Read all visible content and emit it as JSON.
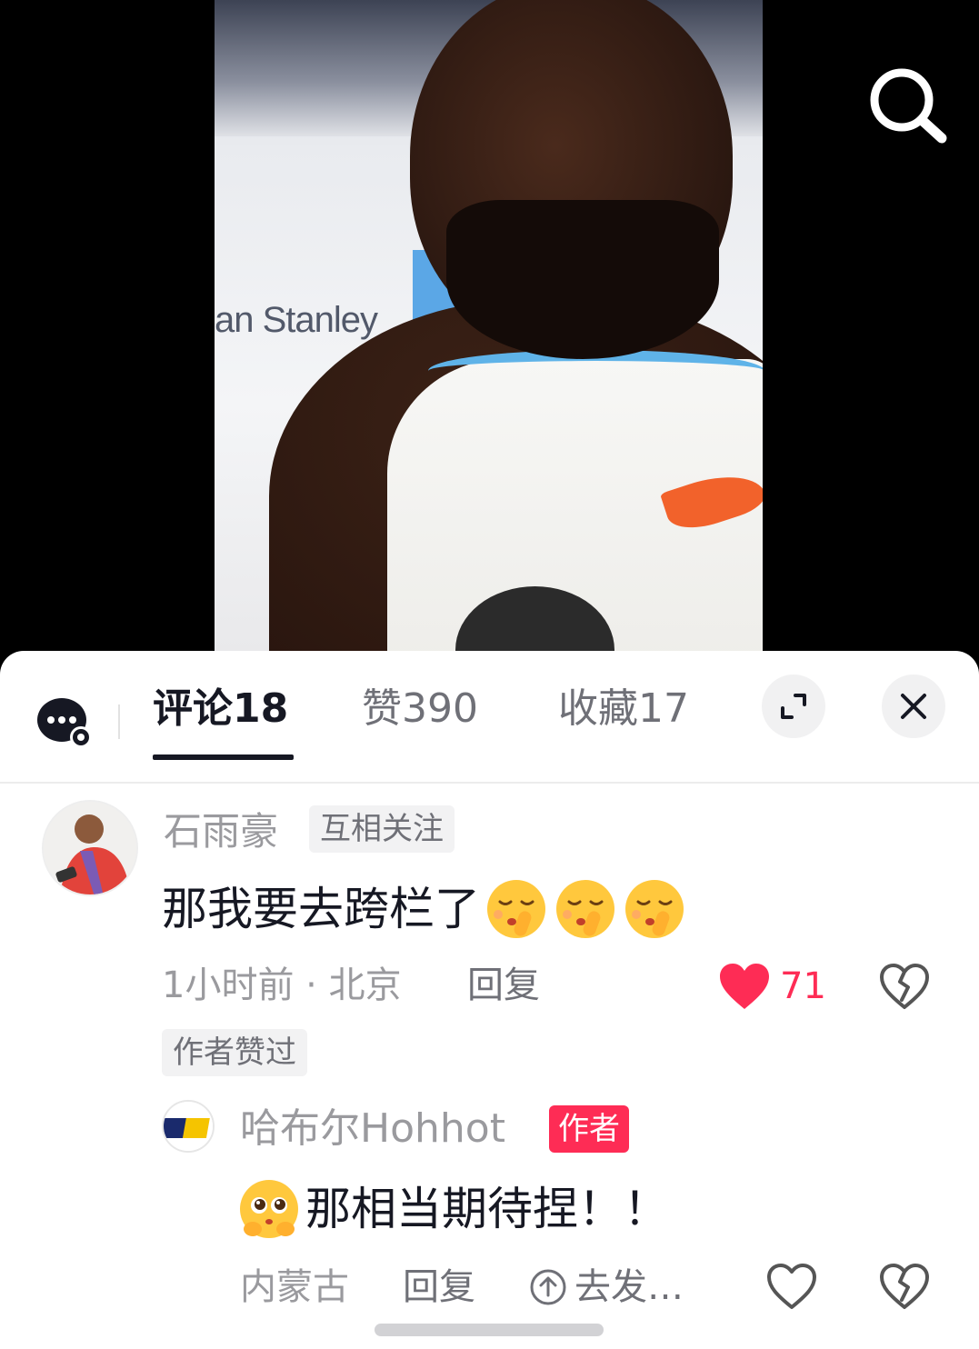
{
  "video": {
    "sponsor_text": "an Stanley"
  },
  "tabs": {
    "comments": "评论18",
    "likes": "赞390",
    "favorites": "收藏17"
  },
  "comments": [
    {
      "username": "石雨豪",
      "relation_badge": "互相关注",
      "text": "那我要去跨栏了",
      "emoji_count": 3,
      "meta": "1小时前 · 北京",
      "reply_label": "回复",
      "like_count": "71",
      "author_liked": "作者赞过"
    }
  ],
  "reply": {
    "username": "哈布尔Hohhot",
    "author_badge": "作者",
    "text": "那相当期待捏！！",
    "meta": "内蒙古",
    "reply_label": "回复",
    "share_label": "去发…"
  },
  "colors": {
    "accent": "#fe2c55",
    "text_primary": "#161823",
    "text_secondary": "#9a9a9e"
  }
}
